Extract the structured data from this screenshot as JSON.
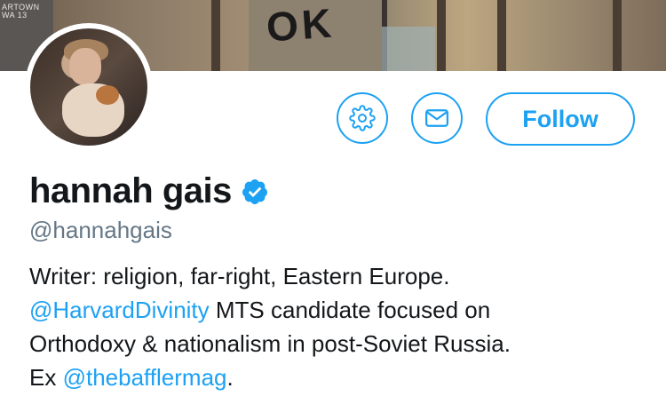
{
  "profile": {
    "name": "hannah gais",
    "handle": "@hannahgais",
    "verified": true
  },
  "banner": {
    "graffiti_left": "ARTOWN WA 13",
    "wall_text": "OK"
  },
  "actions": {
    "settings_icon": "gear-icon",
    "message_icon": "envelope-icon",
    "follow_label": "Follow"
  },
  "bio": {
    "line1": "Writer: religion, far-right, Eastern Europe.",
    "line2_link": "@HarvardDivinity",
    "line2_text": " MTS candidate focused on",
    "line3": "Orthodoxy & nationalism in post-Soviet Russia.",
    "line4_prefix": "Ex ",
    "line4_link": "@thebafflermag",
    "line4_suffix": "."
  },
  "colors": {
    "accent": "#1da1f2",
    "text": "#14171a",
    "muted": "#657786"
  }
}
